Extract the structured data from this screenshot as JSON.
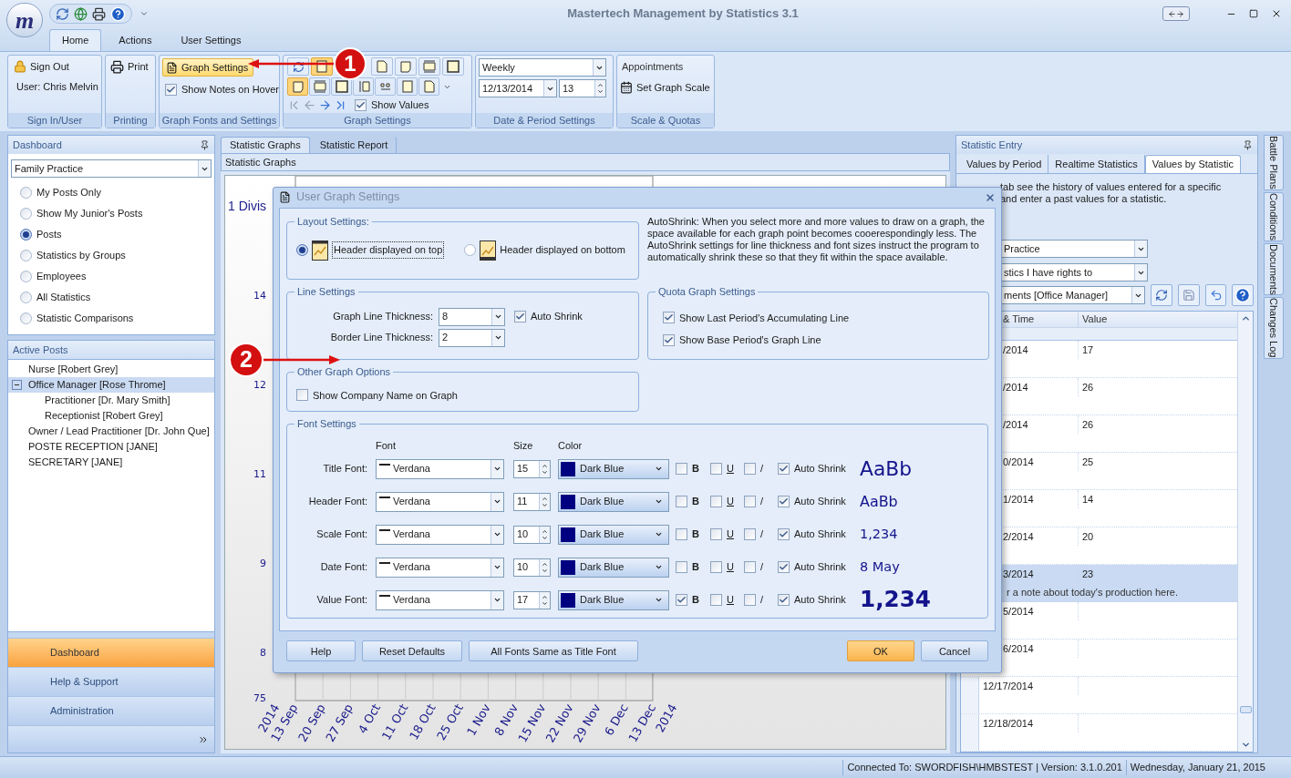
{
  "app": {
    "logo": "m",
    "title": "Mastertech Management by Statistics 3.1"
  },
  "ribbon_tabs": [
    {
      "label": "Home",
      "selected": true
    },
    {
      "label": "Actions",
      "selected": false
    },
    {
      "label": "User Settings",
      "selected": false
    }
  ],
  "ribbon": {
    "sign_in": {
      "button": "Sign Out",
      "user": "User: Chris Melvin",
      "group": "Sign In/User"
    },
    "printing": {
      "button": "Print",
      "group": "Printing"
    },
    "graph_fonts": {
      "button": "Graph Settings",
      "show_notes": {
        "label": "Show Notes on Hover",
        "checked": true
      },
      "group": "Graph Fonts and Settings"
    },
    "graph_settings": {
      "row_1": [
        {
          "selected": true
        },
        {
          "selected": false
        },
        {
          "selected": false
        },
        {
          "selected": false
        },
        {
          "selected": false
        }
      ],
      "row_2": [
        {
          "selected": true
        },
        {
          "selected": false
        },
        {
          "selected": false
        },
        {
          "selected": false
        },
        {
          "selected": false
        },
        {
          "selected": false
        },
        {
          "selected": false
        }
      ],
      "show_values": {
        "label": "Show Values",
        "checked": true
      },
      "group": "Graph Settings"
    },
    "date_period": {
      "period": "Weekly",
      "date": "12/13/2014",
      "count": "13",
      "group": "Date & Period Settings"
    },
    "scale": {
      "statistic": "Appointments",
      "button": "Set Graph Scale",
      "group": "Scale & Quotas"
    }
  },
  "dashboard": {
    "title": "Dashboard",
    "filter": "Family Practice",
    "options": [
      {
        "label": "My Posts Only",
        "selected": false
      },
      {
        "label": "Show My Junior's Posts",
        "selected": false
      },
      {
        "label": "Posts",
        "selected": true
      },
      {
        "label": "Statistics by Groups",
        "selected": false
      },
      {
        "label": "Employees",
        "selected": false
      },
      {
        "label": "All Statistics",
        "selected": false
      },
      {
        "label": "Statistic Comparisons",
        "selected": false
      }
    ]
  },
  "active_posts": {
    "title": "Active Posts",
    "tree": [
      {
        "label": "Nurse [Robert Grey]",
        "selected": false
      },
      {
        "label": "Office Manager [Rose Throme]",
        "selected": true,
        "expanded": true,
        "children": [
          {
            "label": "Practitioner  [Dr. Mary Smith]",
            "selected": false
          },
          {
            "label": "Receptionist  [Robert Grey]",
            "selected": false
          }
        ]
      },
      {
        "label": "Owner / Lead Practitioner  [Dr. John Que]",
        "selected": false
      },
      {
        "label": "POSTE RECEPTION [JANE]",
        "selected": false
      },
      {
        "label": "SECRETARY [JANE]",
        "selected": false
      }
    ]
  },
  "nav": [
    {
      "label": "Dashboard",
      "selected": true
    },
    {
      "label": "Help & Support",
      "selected": false
    },
    {
      "label": "Administration",
      "selected": false
    }
  ],
  "center": {
    "tabs": [
      {
        "label": "Statistic Graphs",
        "selected": true
      },
      {
        "label": "Statistic Report",
        "selected": false
      }
    ],
    "subtitle": "Statistic Graphs",
    "chart": {
      "partial_title": "1 Divis",
      "y_labels": [
        {
          "label": "14"
        },
        {
          "label": "12"
        },
        {
          "label": "11"
        },
        {
          "label": "9"
        },
        {
          "label": "8"
        },
        {
          "label": "75"
        }
      ],
      "x_labels": [
        "13 Sep",
        "20 Sep",
        "27 Sep",
        "4 Oct",
        "11 Oct",
        "18 Oct",
        "25 Oct",
        "1 Nov",
        "8 Nov",
        "15 Nov",
        "22 Nov",
        "29 Nov",
        "6 Dec",
        "13 Dec"
      ],
      "years": [
        "2014",
        "2014"
      ]
    }
  },
  "statistic_entry": {
    "title": "Statistic Entry",
    "tabs": [
      {
        "label": "Values by Period",
        "selected": false
      },
      {
        "label": "Realtime Statistics",
        "selected": false
      },
      {
        "label": "Values by Statistic",
        "selected": true
      }
    ],
    "description": [
      "tab see the history of values entered for a specific",
      "and enter a past values for a statistic."
    ],
    "filters": [
      "Practice",
      "stics I have rights to",
      "ments [Office Manager]"
    ],
    "columns": [
      "& Time",
      "Value"
    ],
    "rows": [
      {
        "date": "/2014",
        "value": "17",
        "selected": false
      },
      {
        "date": "/2014",
        "value": "26",
        "selected": false
      },
      {
        "date": "/2014",
        "value": "26",
        "selected": false
      },
      {
        "date": "0/2014",
        "value": "25",
        "selected": false
      },
      {
        "date": "1/2014",
        "value": "14",
        "selected": false
      },
      {
        "date": "2/2014",
        "value": "20",
        "selected": false
      },
      {
        "date": "3/2014",
        "value": "23",
        "note": "r a note about today's production here.",
        "selected": true
      },
      {
        "date": "5/2014",
        "selected": false
      },
      {
        "date": "6/2014",
        "selected": false
      },
      {
        "date": "12/17/2014",
        "selected": false
      },
      {
        "date": "12/18/2014",
        "selected": false
      }
    ]
  },
  "side_tabs": [
    "Battle Plans",
    "Conditions",
    "Documents",
    "Changes Log"
  ],
  "status_bar": {
    "connection": "Connected To: SWORDFISH\\HMBSTEST | Version: 3.1.0.201",
    "date": "Wednesday, January 21, 2015"
  },
  "dialog": {
    "title": "User Graph Settings",
    "layout": {
      "title": "Layout Settings:",
      "options": [
        {
          "label": "Header displayed on top",
          "selected": true
        },
        {
          "label": "Header displayed on bottom",
          "selected": false
        }
      ]
    },
    "note": "AutoShrink: When you select more and more values to draw on a graph, the space available for each graph point becomes cooerespondingly less. The AutoShrink settings for line thickness and font sizes instruct the program to automatically shrink these so that they fit within the space available.",
    "line": {
      "title": "Line Settings",
      "graph_label": "Graph Line Thickness:",
      "graph_value": "8",
      "border_label": "Border Line Thickness:",
      "border_value": "2",
      "auto_shrink": {
        "label": "Auto Shrink",
        "checked": true
      }
    },
    "quota": {
      "title": "Quota Graph Settings",
      "options": [
        {
          "label": "Show Last Period's Accumulating Line",
          "checked": true
        },
        {
          "label": "Show Base Period's Graph Line",
          "checked": true
        }
      ]
    },
    "other": {
      "title": "Other Graph Options",
      "options": [
        {
          "label": "Show Company Name on Graph",
          "checked": false
        }
      ]
    },
    "fonts": {
      "title": "Font Settings",
      "headers": [
        "Font",
        "Size",
        "Color"
      ],
      "rows": [
        {
          "label": "Title Font:",
          "font": "Verdana",
          "size": "15",
          "color_name": "Dark Blue",
          "color": "#000080",
          "bold": {
            "label": "B",
            "checked": false
          },
          "underline": {
            "label": "U",
            "checked": false
          },
          "italic": {
            "label": "/",
            "checked": false
          },
          "auto_shrink": {
            "label": "Auto Shrink",
            "checked": true
          },
          "preview": "AaBb"
        },
        {
          "label": "Header Font:",
          "font": "Verdana",
          "size": "11",
          "color_name": "Dark Blue",
          "color": "#000080",
          "bold": {
            "label": "B",
            "checked": false
          },
          "underline": {
            "label": "U",
            "checked": false
          },
          "italic": {
            "label": "/",
            "checked": false
          },
          "auto_shrink": {
            "label": "Auto Shrink",
            "checked": true
          },
          "preview": "AaBb"
        },
        {
          "label": "Scale Font:",
          "font": "Verdana",
          "size": "10",
          "color_name": "Dark Blue",
          "color": "#000080",
          "bold": {
            "label": "B",
            "checked": false
          },
          "underline": {
            "label": "U",
            "checked": false
          },
          "italic": {
            "label": "/",
            "checked": false
          },
          "auto_shrink": {
            "label": "Auto Shrink",
            "checked": true
          },
          "preview": "1,234"
        },
        {
          "label": "Date Font:",
          "font": "Verdana",
          "size": "10",
          "color_name": "Dark Blue",
          "color": "#000080",
          "bold": {
            "label": "B",
            "checked": false
          },
          "underline": {
            "label": "U",
            "checked": false
          },
          "italic": {
            "label": "/",
            "checked": false
          },
          "auto_shrink": {
            "label": "Auto Shrink",
            "checked": true
          },
          "preview": "8 May"
        },
        {
          "label": "Value Font:",
          "font": "Verdana",
          "size": "17",
          "color_name": "Dark Blue",
          "color": "#000080",
          "bold": {
            "label": "B",
            "checked": true
          },
          "underline": {
            "label": "U",
            "checked": false
          },
          "italic": {
            "label": "/",
            "checked": false
          },
          "auto_shrink": {
            "label": "Auto Shrink",
            "checked": true
          },
          "preview": "1,234"
        }
      ]
    },
    "buttons": [
      {
        "label": "Help",
        "kind": "plain"
      },
      {
        "label": "Reset Defaults",
        "kind": "plain"
      },
      {
        "label": "All Fonts Same as Title Font",
        "kind": "plain"
      },
      {
        "label": "OK",
        "kind": "default"
      },
      {
        "label": "Cancel",
        "kind": "plain"
      }
    ]
  },
  "callouts": [
    {
      "number": "1"
    },
    {
      "number": "2"
    }
  ]
}
